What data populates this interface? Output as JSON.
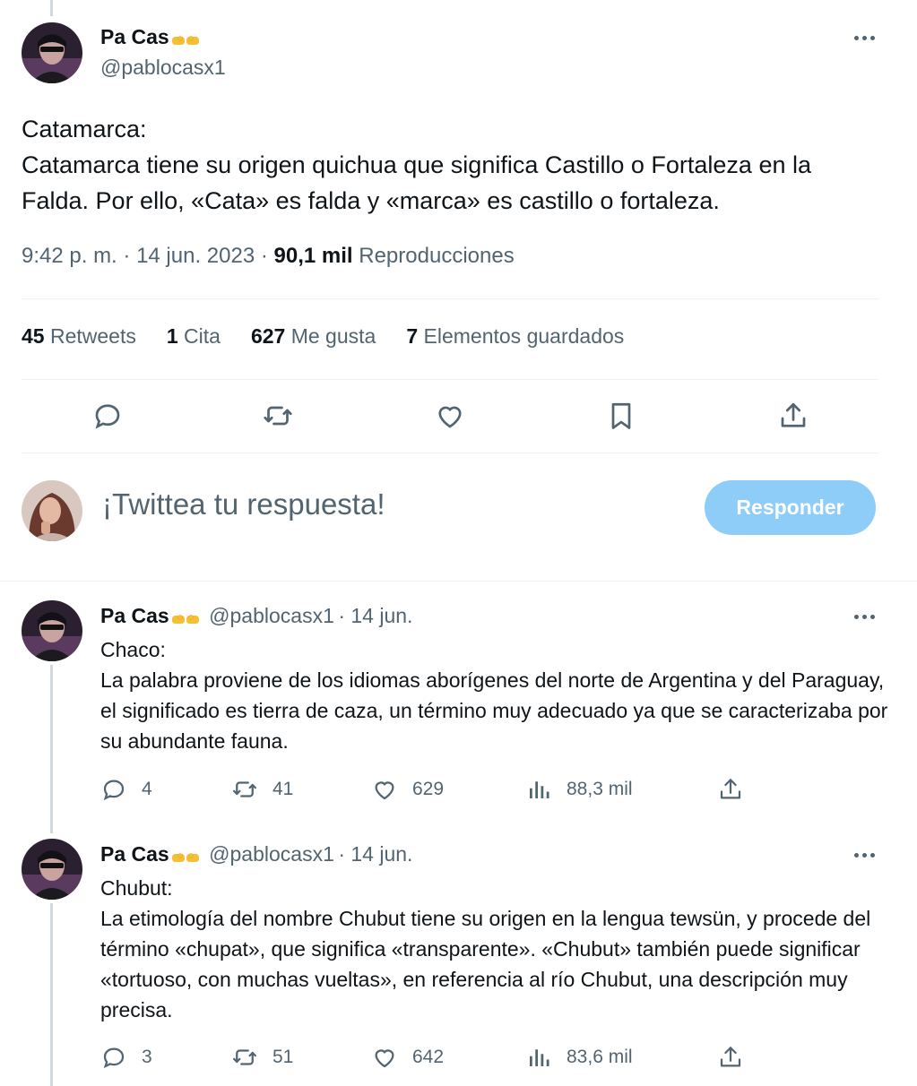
{
  "main_tweet": {
    "author_name": "Pa Cas",
    "author_handle": "@pablocasx1",
    "text_lines": [
      "Catamarca:",
      "Catamarca tiene su origen quichua que significa Castillo o Fortaleza en la Falda. Por ello, «Cata» es falda y «marca» es castillo o fortaleza."
    ],
    "time": "9:42 p. m.",
    "date": "14 jun. 2023",
    "views_count": "90,1 mil",
    "views_label": "Reproducciones",
    "stats": {
      "retweets_count": "45",
      "retweets_label": "Retweets",
      "quotes_count": "1",
      "quotes_label": "Cita",
      "likes_count": "627",
      "likes_label": "Me gusta",
      "bookmarks_count": "7",
      "bookmarks_label": "Elementos guardados"
    },
    "actions": [
      "reply-icon",
      "retweet-icon",
      "like-icon",
      "bookmark-icon",
      "share-icon"
    ]
  },
  "composer": {
    "placeholder": "¡Twittea tu respuesta!",
    "button_label": "Responder",
    "button_color": "#8ecdf8"
  },
  "replies": [
    {
      "author_name": "Pa Cas",
      "author_handle": "@pablocasx1",
      "date": "· 14 jun.",
      "title": "Chaco:",
      "body": "La palabra proviene de los idiomas aborígenes del norte de Argentina y del Paraguay, el significado es tierra de caza, un término muy adecuado ya que se caracterizaba por su abundante fauna.",
      "replies": "4",
      "retweets": "41",
      "likes": "629",
      "views": "88,3 mil"
    },
    {
      "author_name": "Pa Cas",
      "author_handle": "@pablocasx1",
      "date": "· 14 jun.",
      "title": "Chubut:",
      "body": "La etimología del nombre Chubut tiene su origen en la lengua tewsün, y procede del término «chupat», que significa «transparente». «Chubut» también puede significar «tortuoso, con muchas vueltas», en referencia al río Chubut, una descripción muy precisa.",
      "replies": "3",
      "retweets": "51",
      "likes": "642",
      "views": "83,6 mil"
    }
  ],
  "colors": {
    "text_primary": "#0f1419",
    "text_secondary": "#536471",
    "divider": "#eff3f4",
    "thread_line": "#cfd9de"
  }
}
